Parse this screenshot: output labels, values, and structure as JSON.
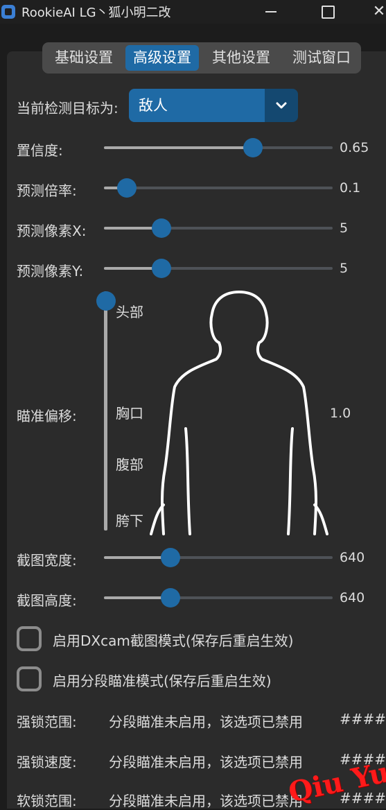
{
  "window": {
    "title": "RookieAI LG丶狐小明二改",
    "icons": [
      "app-icon",
      "minimize-icon",
      "maximize-icon",
      "close-icon"
    ]
  },
  "tabs": [
    {
      "label": "基础设置",
      "active": false
    },
    {
      "label": "高级设置",
      "active": true
    },
    {
      "label": "其他设置",
      "active": false
    },
    {
      "label": "测试窗口",
      "active": false
    }
  ],
  "target": {
    "label": "当前检测目标为:",
    "selected": "敌人"
  },
  "sliders": {
    "confidence": {
      "label": "置信度:",
      "value": "0.65",
      "fraction": 0.65
    },
    "prediction_rate": {
      "label": "预测倍率:",
      "value": "0.1",
      "fraction": 0.1
    },
    "prediction_x": {
      "label": "预测像素X:",
      "value": "5",
      "fraction": 0.25
    },
    "prediction_y": {
      "label": "预测像素Y:",
      "value": "5",
      "fraction": 0.25
    },
    "capture_width": {
      "label": "截图宽度:",
      "value": "640",
      "fraction": 0.29
    },
    "capture_height": {
      "label": "截图高度:",
      "value": "640",
      "fraction": 0.29
    }
  },
  "aim_offset": {
    "label": "瞄准偏移:",
    "value": "1.0",
    "fraction": 1.0,
    "positions": [
      "头部",
      "胸口",
      "腹部",
      "胯下"
    ]
  },
  "checkboxes": [
    {
      "label": "启用DXcam截图模式(保存后重启生效)",
      "checked": false
    },
    {
      "label": "启用分段瞄准模式(保存后重启生效)",
      "checked": false
    }
  ],
  "locked_rows": [
    {
      "label": "强锁范围:",
      "text": "分段瞄准未启用，该选项已禁用",
      "value": "####"
    },
    {
      "label": "强锁速度:",
      "text": "分段瞄准未启用，该选项已禁用",
      "value": "####"
    },
    {
      "label": "软锁范围:",
      "text": "分段瞄准未启用，该选项已禁用",
      "value": "####"
    }
  ],
  "watermark": "Qiu Yue",
  "colors": {
    "accent": "#1f6aa5",
    "accent_dark": "#144870",
    "background": "#2b2b2b",
    "watermark": "#ff1a1a"
  }
}
